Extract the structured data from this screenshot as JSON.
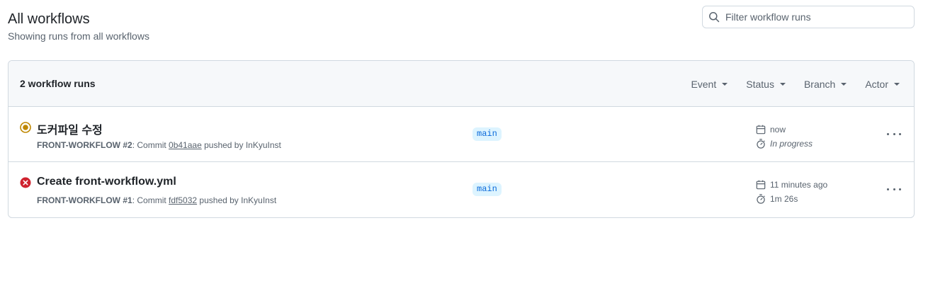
{
  "page": {
    "title": "All workflows",
    "subtitle": "Showing runs from all workflows"
  },
  "search": {
    "placeholder": "Filter workflow runs",
    "value": ""
  },
  "runs_header": {
    "count_label": "2 workflow runs",
    "filters": [
      "Event",
      "Status",
      "Branch",
      "Actor"
    ]
  },
  "runs": [
    {
      "status": "in-progress",
      "title": "도커파일 수정",
      "workflow": "FRONT-WORKFLOW",
      "run_number": "#2",
      "commit_prefix": ": Commit",
      "commit_sha": "0b41aae",
      "pushed_by_prefix": "pushed by",
      "actor": "InKyuInst",
      "branch": "main",
      "time_ago": "now",
      "duration": "In progress"
    },
    {
      "status": "failure",
      "title": "Create front-workflow.yml",
      "workflow": "FRONT-WORKFLOW",
      "run_number": "#1",
      "commit_prefix": ": Commit",
      "commit_sha": "fdf5032",
      "pushed_by_prefix": "pushed by",
      "actor": "InKyuInst",
      "branch": "main",
      "time_ago": "11 minutes ago",
      "duration": "1m 26s"
    }
  ],
  "colors": {
    "in_progress": "#bf8700",
    "failure": "#cf222e",
    "branch_bg": "#ddf4ff",
    "branch_fg": "#0969da",
    "muted": "#59636e"
  },
  "icons": {
    "search": "search-icon",
    "calendar": "calendar-icon",
    "stopwatch": "stopwatch-icon",
    "kebab": "kebab-horizontal-icon"
  }
}
